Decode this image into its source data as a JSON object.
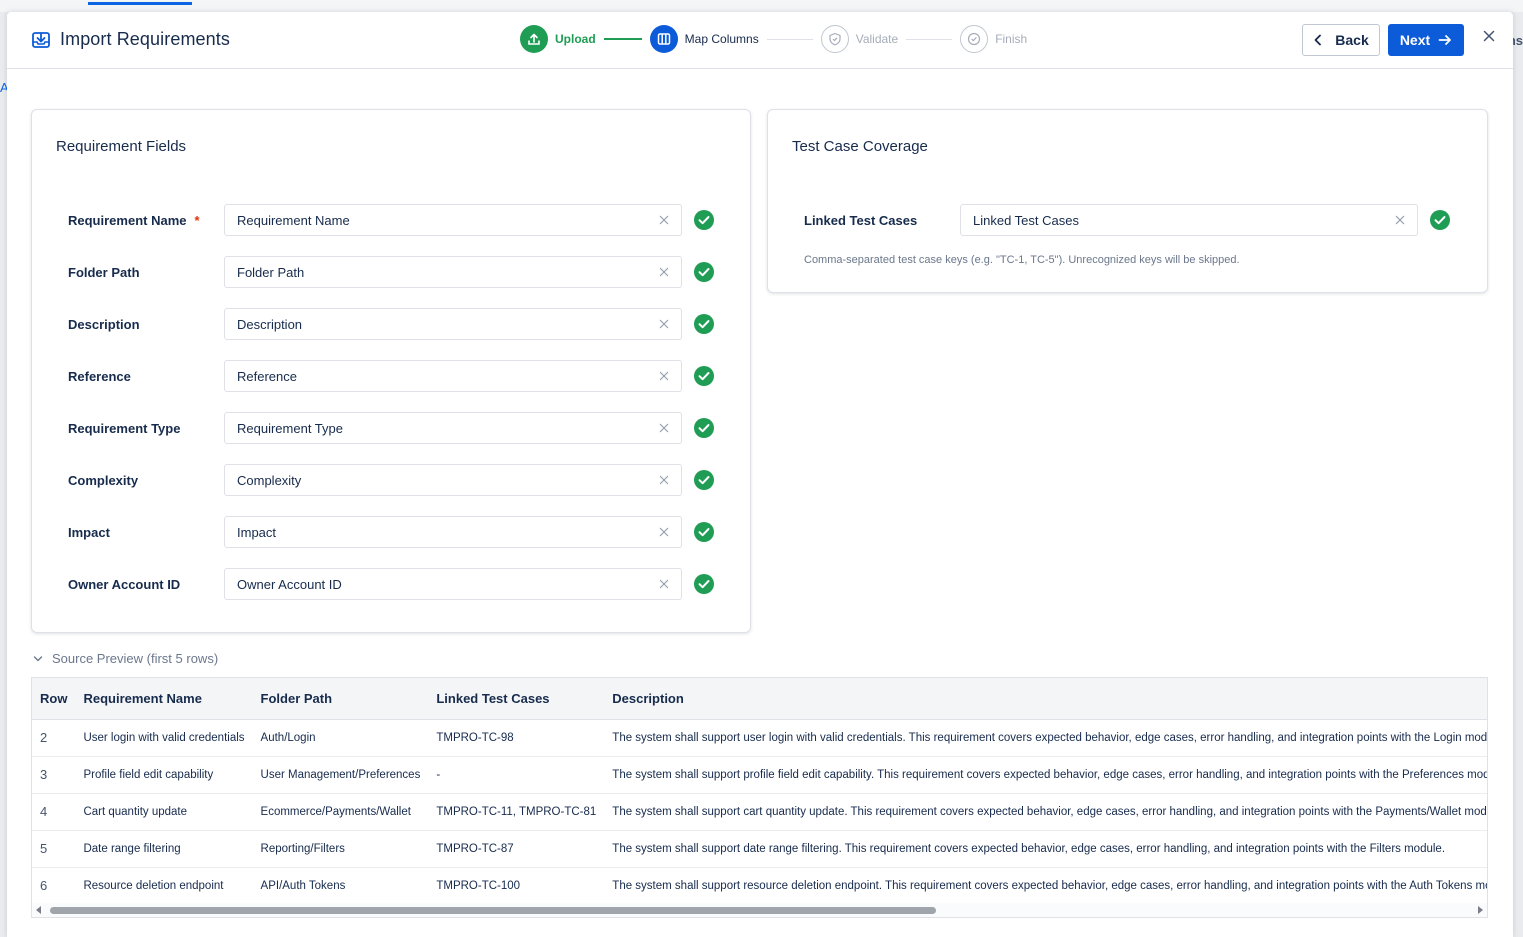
{
  "colors": {
    "accent": "#0c5bd8",
    "success": "#1f9d55",
    "required": "#de350b",
    "muted": "#6b778c"
  },
  "modal": {
    "title": "Import Requirements",
    "title_icon": "import-tray-icon"
  },
  "stepper": {
    "steps": [
      {
        "label": "Upload",
        "state": "done",
        "icon": "upload-icon"
      },
      {
        "label": "Map Columns",
        "state": "active",
        "icon": "columns-icon"
      },
      {
        "label": "Validate",
        "state": "pending",
        "icon": "shield-check-icon"
      },
      {
        "label": "Finish",
        "state": "pending",
        "icon": "check-circle-icon"
      }
    ]
  },
  "actions": {
    "back_label": "Back",
    "next_label": "Next"
  },
  "requirement_fields": {
    "title": "Requirement Fields",
    "fields": [
      {
        "label": "Requirement Name",
        "required": true,
        "value": "Requirement Name"
      },
      {
        "label": "Folder Path",
        "required": false,
        "value": "Folder Path"
      },
      {
        "label": "Description",
        "required": false,
        "value": "Description"
      },
      {
        "label": "Reference",
        "required": false,
        "value": "Reference"
      },
      {
        "label": "Requirement Type",
        "required": false,
        "value": "Requirement Type"
      },
      {
        "label": "Complexity",
        "required": false,
        "value": "Complexity"
      },
      {
        "label": "Impact",
        "required": false,
        "value": "Impact"
      },
      {
        "label": "Owner Account ID",
        "required": false,
        "value": "Owner Account ID"
      }
    ],
    "required_marker": "*"
  },
  "test_case_coverage": {
    "title": "Test Case Coverage",
    "field_label": "Linked Test Cases",
    "field_value": "Linked Test Cases",
    "helper": "Comma-separated test case keys (e.g. \"TC-1, TC-5\"). Unrecognized keys will be skipped."
  },
  "preview": {
    "toggle_label": "Source Preview (first 5 rows)",
    "columns": [
      "Row",
      "Requirement Name",
      "Folder Path",
      "Linked Test Cases",
      "Description"
    ],
    "rows": [
      [
        "2",
        "User login with valid credentials",
        "Auth/Login",
        "TMPRO-TC-98",
        "The system shall support user login with valid credentials. This requirement covers expected behavior, edge cases, error handling, and integration points with the Login module."
      ],
      [
        "3",
        "Profile field edit capability",
        "User Management/Preferences",
        "-",
        "The system shall support profile field edit capability. This requirement covers expected behavior, edge cases, error handling, and integration points with the Preferences module."
      ],
      [
        "4",
        "Cart quantity update",
        "Ecommerce/Payments/Wallet",
        "TMPRO-TC-11, TMPRO-TC-81",
        "The system shall support cart quantity update. This requirement covers expected behavior, edge cases, error handling, and integration points with the Payments/Wallet module."
      ],
      [
        "5",
        "Date range filtering",
        "Reporting/Filters",
        "TMPRO-TC-87",
        "The system shall support date range filtering. This requirement covers expected behavior, edge cases, error handling, and integration points with the Filters module."
      ],
      [
        "6",
        "Resource deletion endpoint",
        "API/Auth Tokens",
        "TMPRO-TC-100",
        "The system shall support resource deletion endpoint. This requirement covers expected behavior, edge cases, error handling, and integration points with the Auth Tokens module."
      ]
    ]
  },
  "background": {
    "right_edge_text": "ns",
    "left_edge_text": "A"
  }
}
